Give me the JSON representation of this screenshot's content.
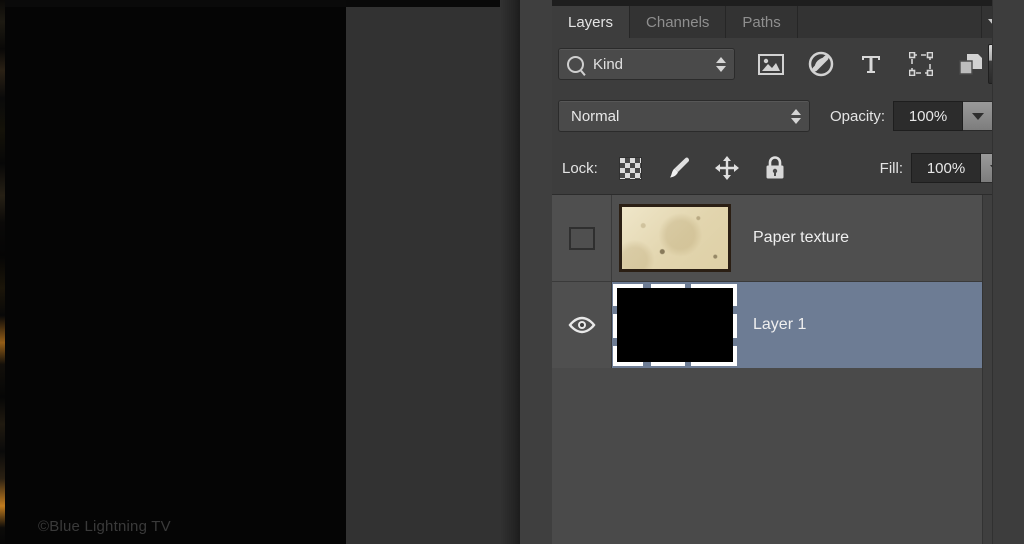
{
  "canvas": {
    "watermark": "©Blue Lightning TV"
  },
  "panel": {
    "tabs": [
      {
        "label": "Layers",
        "active": true
      },
      {
        "label": "Channels",
        "active": false
      },
      {
        "label": "Paths",
        "active": false
      }
    ],
    "menu_icon": "panel-menu-icon",
    "filter": {
      "search_icon": "magnifier-icon",
      "kind_label": "Kind",
      "stepper_icon": "stepper-updown-icon",
      "type_filters": [
        {
          "icon": "pixel-layer-icon",
          "title": "Filter for pixel layers"
        },
        {
          "icon": "adjustment-layer-icon",
          "title": "Filter for adjustment layers"
        },
        {
          "icon": "type-layer-icon",
          "title": "Filter for type layers"
        },
        {
          "icon": "shape-layer-icon",
          "title": "Filter for shape layers"
        },
        {
          "icon": "smart-object-icon",
          "title": "Filter for smart objects"
        }
      ],
      "toggle_icon": "filter-toggle-switch"
    },
    "blend": {
      "mode": "Normal",
      "opacity_label": "Opacity:",
      "opacity_value": "100%",
      "dropdown_icon": "chevron-down-icon"
    },
    "lock": {
      "label": "Lock:",
      "items": [
        {
          "icon": "lock-transparent-pixels-icon"
        },
        {
          "icon": "lock-image-pixels-icon"
        },
        {
          "icon": "lock-position-icon"
        },
        {
          "icon": "lock-all-icon"
        }
      ],
      "fill_label": "Fill:",
      "fill_value": "100%"
    },
    "layers": [
      {
        "name": "Paper texture",
        "visible": false,
        "selected": false,
        "visibility_icon": "eye-hidden-icon",
        "thumbnail": "paper-texture-thumbnail"
      },
      {
        "name": "Layer 1",
        "visible": true,
        "selected": true,
        "visibility_icon": "eye-visible-icon",
        "thumbnail": "black-layer-thumbnail"
      }
    ]
  },
  "colors": {
    "panel_bg": "#3d3d3d",
    "list_bg": "#4a4a4a",
    "row_bg": "#4f4f4f",
    "selection": "#6d7c94",
    "text": "#e8e8e8",
    "tab_inactive_text": "#8f8f8f",
    "canvas": "#050505",
    "paper_thumb": "#e7dcbb"
  }
}
